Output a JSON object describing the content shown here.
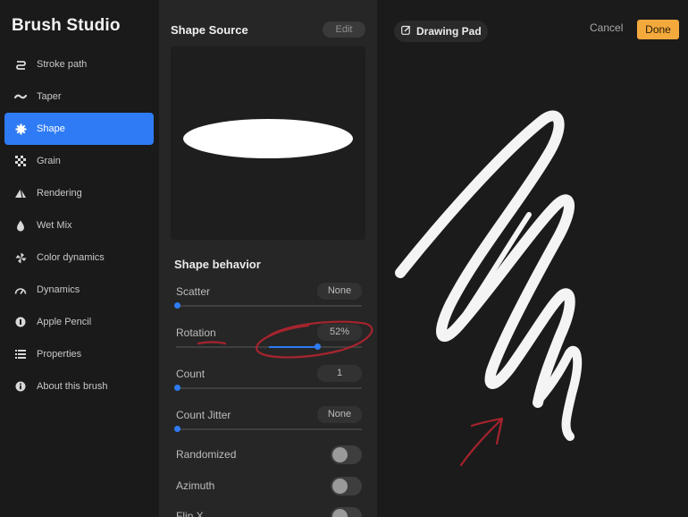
{
  "sidebar": {
    "title": "Brush Studio",
    "items": [
      {
        "label": "Stroke path",
        "icon": "stroke-path-icon",
        "active": false
      },
      {
        "label": "Taper",
        "icon": "taper-icon",
        "active": false
      },
      {
        "label": "Shape",
        "icon": "shape-icon",
        "active": true
      },
      {
        "label": "Grain",
        "icon": "grain-icon",
        "active": false
      },
      {
        "label": "Rendering",
        "icon": "rendering-icon",
        "active": false
      },
      {
        "label": "Wet Mix",
        "icon": "wet-mix-icon",
        "active": false
      },
      {
        "label": "Color dynamics",
        "icon": "color-dynamics-icon",
        "active": false
      },
      {
        "label": "Dynamics",
        "icon": "dynamics-icon",
        "active": false
      },
      {
        "label": "Apple Pencil",
        "icon": "apple-pencil-icon",
        "active": false
      },
      {
        "label": "Properties",
        "icon": "properties-icon",
        "active": false
      },
      {
        "label": "About this brush",
        "icon": "info-icon",
        "active": false
      }
    ]
  },
  "panel": {
    "source_title": "Shape Source",
    "edit_label": "Edit",
    "behavior_title": "Shape behavior",
    "sliders": [
      {
        "label": "Scatter",
        "value": "None",
        "level": 0
      },
      {
        "label": "Rotation",
        "value": "52%",
        "level": 0.52
      },
      {
        "label": "Count",
        "value": "1",
        "level": 0
      },
      {
        "label": "Count Jitter",
        "value": "None",
        "level": 0
      }
    ],
    "toggles": [
      {
        "label": "Randomized",
        "on": false
      },
      {
        "label": "Azimuth",
        "on": false
      },
      {
        "label": "Flip X",
        "on": false
      }
    ]
  },
  "pad": {
    "title": "Drawing Pad",
    "cancel_label": "Cancel",
    "done_label": "Done"
  },
  "colors": {
    "accent": "#2f7bf5",
    "done": "#f4a93d",
    "annotation": "#b3242f"
  }
}
